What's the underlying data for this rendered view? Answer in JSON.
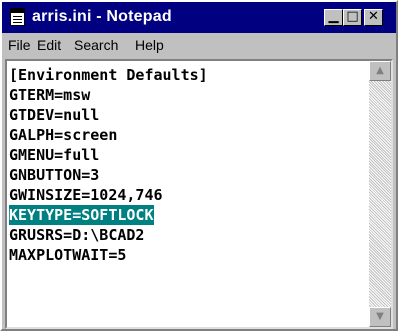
{
  "window": {
    "title": "arris.ini - Notepad",
    "minimize_glyph": "▁",
    "maximize_glyph": "□",
    "close_glyph": "✕"
  },
  "menu": [
    {
      "label": "File"
    },
    {
      "label": "Edit"
    },
    {
      "label": "Search"
    },
    {
      "label": "Help"
    }
  ],
  "document": {
    "lines": [
      "[Environment Defaults]",
      "GTERM=msw",
      "GTDEV=null",
      "GALPH=screen",
      "GMENU=full",
      "GNBUTTON=3",
      "GWINSIZE=1024,746",
      "KEYTYPE=SOFTLOCK",
      "GRUSRS=D:\\BCAD2",
      "MAXPLOTWAIT=5"
    ],
    "selected_line_index": 7
  },
  "scrollbar": {
    "up_glyph": "▲",
    "down_glyph": "▼"
  },
  "colors": {
    "title_bar": "#000080",
    "selection": "#008080",
    "chrome": "#c0c0c0"
  }
}
